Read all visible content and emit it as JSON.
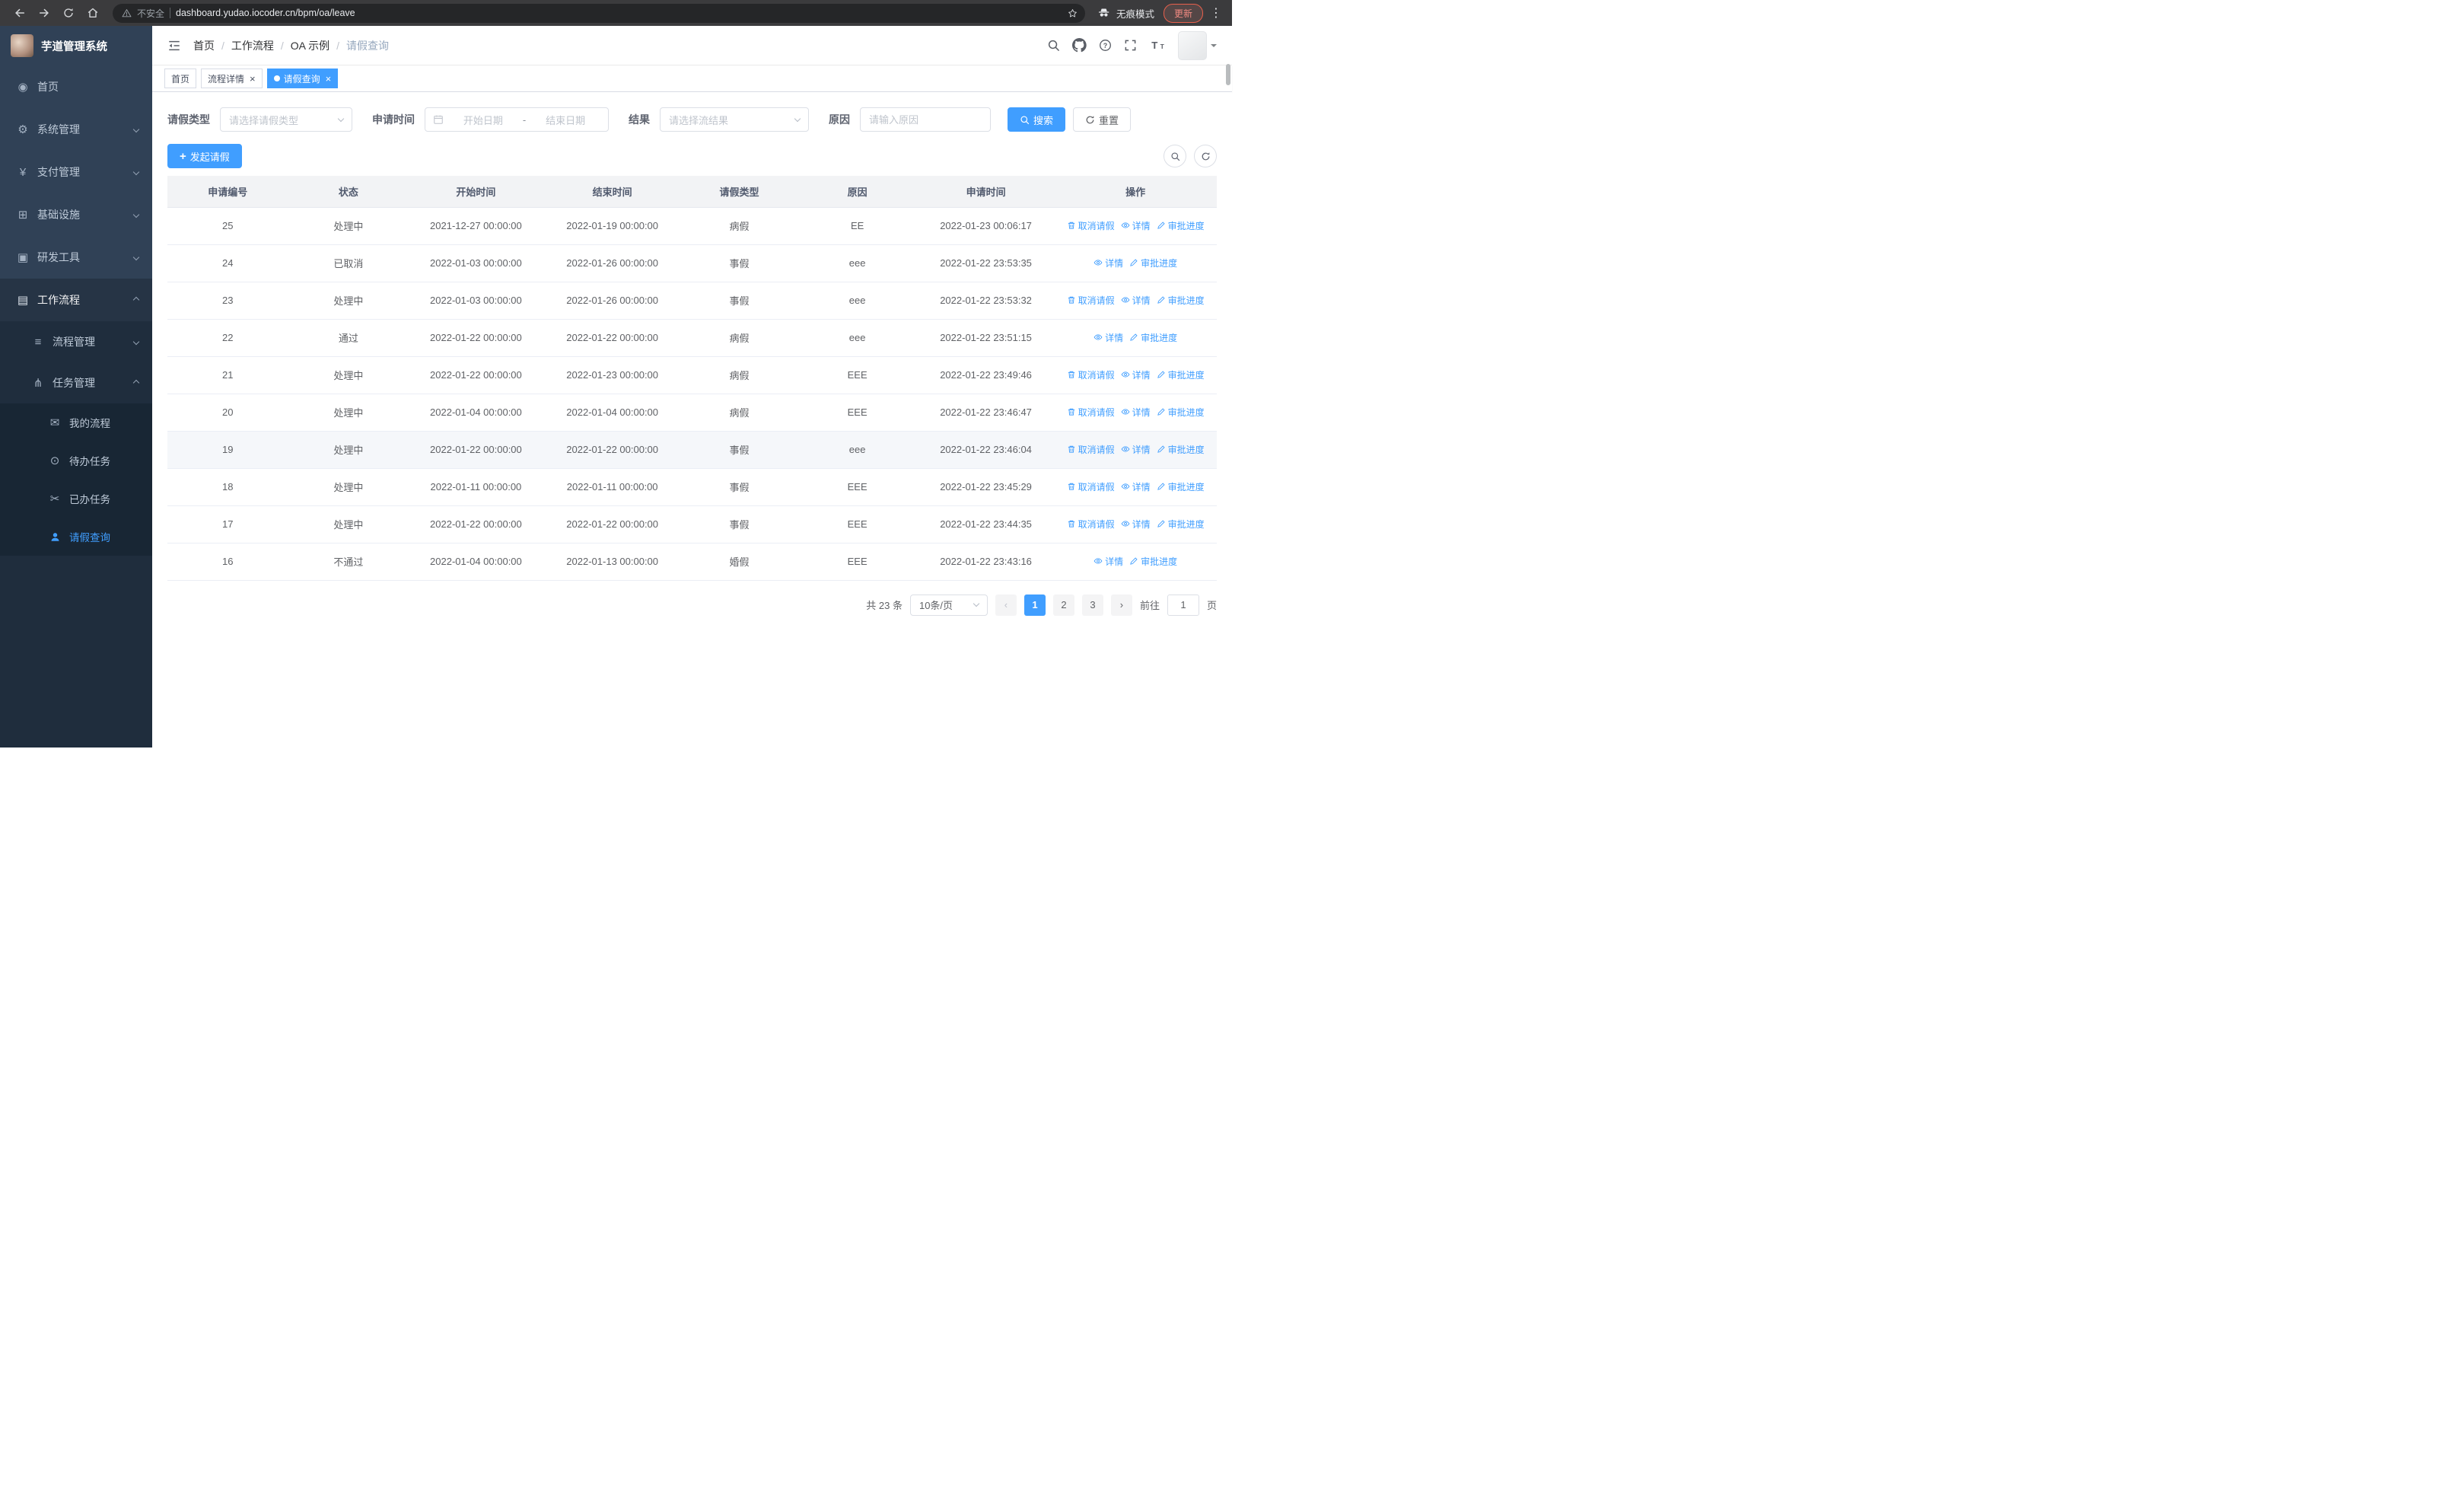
{
  "colors": {
    "accent": "#409eff",
    "chrome_bg": "#3b3b3d",
    "sidebar_bg": "#304156",
    "submenu_bg": "#1f2d3d"
  },
  "browser": {
    "security_warning": "不安全",
    "url": "dashboard.yudao.iocoder.cn/bpm/oa/leave",
    "incognito_label": "无痕模式",
    "update_label": "更新"
  },
  "sidebar": {
    "logo_title": "芋道管理系统",
    "items": [
      {
        "label": "首页",
        "icon": "dashboard",
        "chevron": null
      },
      {
        "label": "系统管理",
        "icon": "gear",
        "chevron": "down"
      },
      {
        "label": "支付管理",
        "icon": "yen",
        "chevron": "down"
      },
      {
        "label": "基础设施",
        "icon": "infra",
        "chevron": "down"
      },
      {
        "label": "研发工具",
        "icon": "tools",
        "chevron": "down"
      },
      {
        "label": "工作流程",
        "icon": "workflow",
        "chevron": "up",
        "expanded": true
      }
    ],
    "workflow_children": [
      {
        "label": "流程管理",
        "icon": "list",
        "chevron": "down",
        "level": 2
      },
      {
        "label": "任务管理",
        "icon": "fork",
        "chevron": "up",
        "level": 2,
        "expanded": true
      },
      {
        "label": "我的流程",
        "icon": "message",
        "level": 3
      },
      {
        "label": "待办任务",
        "icon": "eye",
        "level": 3
      },
      {
        "label": "已办任务",
        "icon": "scissors",
        "level": 3
      },
      {
        "label": "请假查询",
        "icon": "user",
        "level": 3,
        "active": true
      }
    ]
  },
  "header": {
    "breadcrumb": [
      "首页",
      "工作流程",
      "OA 示例",
      "请假查询"
    ]
  },
  "tabs": [
    {
      "label": "首页",
      "closable": false,
      "active": false
    },
    {
      "label": "流程详情",
      "closable": true,
      "active": false
    },
    {
      "label": "请假查询",
      "closable": true,
      "active": true
    }
  ],
  "filters": {
    "leave_type_label": "请假类型",
    "leave_type_placeholder": "请选择请假类型",
    "apply_time_label": "申请时间",
    "start_date_placeholder": "开始日期",
    "range_separator": "-",
    "end_date_placeholder": "结束日期",
    "result_label": "结果",
    "result_placeholder": "请选择流结果",
    "reason_label": "原因",
    "reason_placeholder": "请输入原因",
    "search_button": "搜索",
    "reset_button": "重置"
  },
  "toolbar": {
    "create_button": "发起请假"
  },
  "table": {
    "columns": [
      "申请编号",
      "状态",
      "开始时间",
      "结束时间",
      "请假类型",
      "原因",
      "申请时间",
      "操作"
    ],
    "action_labels": {
      "cancel": "取消请假",
      "detail": "详情",
      "progress": "审批进度"
    },
    "rows": [
      {
        "id": "25",
        "status": "处理中",
        "start": "2021-12-27 00:00:00",
        "end": "2022-01-19 00:00:00",
        "type": "病假",
        "reason": "EE",
        "applied": "2022-01-23 00:06:17",
        "actions": [
          "cancel",
          "detail",
          "progress"
        ]
      },
      {
        "id": "24",
        "status": "已取消",
        "start": "2022-01-03 00:00:00",
        "end": "2022-01-26 00:00:00",
        "type": "事假",
        "reason": "eee",
        "applied": "2022-01-22 23:53:35",
        "actions": [
          "detail",
          "progress"
        ]
      },
      {
        "id": "23",
        "status": "处理中",
        "start": "2022-01-03 00:00:00",
        "end": "2022-01-26 00:00:00",
        "type": "事假",
        "reason": "eee",
        "applied": "2022-01-22 23:53:32",
        "actions": [
          "cancel",
          "detail",
          "progress"
        ]
      },
      {
        "id": "22",
        "status": "通过",
        "start": "2022-01-22 00:00:00",
        "end": "2022-01-22 00:00:00",
        "type": "病假",
        "reason": "eee",
        "applied": "2022-01-22 23:51:15",
        "actions": [
          "detail",
          "progress"
        ]
      },
      {
        "id": "21",
        "status": "处理中",
        "start": "2022-01-22 00:00:00",
        "end": "2022-01-23 00:00:00",
        "type": "病假",
        "reason": "EEE",
        "applied": "2022-01-22 23:49:46",
        "actions": [
          "cancel",
          "detail",
          "progress"
        ]
      },
      {
        "id": "20",
        "status": "处理中",
        "start": "2022-01-04 00:00:00",
        "end": "2022-01-04 00:00:00",
        "type": "病假",
        "reason": "EEE",
        "applied": "2022-01-22 23:46:47",
        "actions": [
          "cancel",
          "detail",
          "progress"
        ]
      },
      {
        "id": "19",
        "status": "处理中",
        "start": "2022-01-22 00:00:00",
        "end": "2022-01-22 00:00:00",
        "type": "事假",
        "reason": "eee",
        "applied": "2022-01-22 23:46:04",
        "actions": [
          "cancel",
          "detail",
          "progress"
        ],
        "highlighted": true
      },
      {
        "id": "18",
        "status": "处理中",
        "start": "2022-01-11 00:00:00",
        "end": "2022-01-11 00:00:00",
        "type": "事假",
        "reason": "EEE",
        "applied": "2022-01-22 23:45:29",
        "actions": [
          "cancel",
          "detail",
          "progress"
        ]
      },
      {
        "id": "17",
        "status": "处理中",
        "start": "2022-01-22 00:00:00",
        "end": "2022-01-22 00:00:00",
        "type": "事假",
        "reason": "EEE",
        "applied": "2022-01-22 23:44:35",
        "actions": [
          "cancel",
          "detail",
          "progress"
        ]
      },
      {
        "id": "16",
        "status": "不通过",
        "start": "2022-01-04 00:00:00",
        "end": "2022-01-13 00:00:00",
        "type": "婚假",
        "reason": "EEE",
        "applied": "2022-01-22 23:43:16",
        "actions": [
          "detail",
          "progress"
        ]
      }
    ]
  },
  "pagination": {
    "total_text": "共 23 条",
    "page_size": "10条/页",
    "pages": [
      "1",
      "2",
      "3"
    ],
    "active_page": "1",
    "goto_label": "前往",
    "goto_value": "1",
    "goto_suffix": "页"
  }
}
